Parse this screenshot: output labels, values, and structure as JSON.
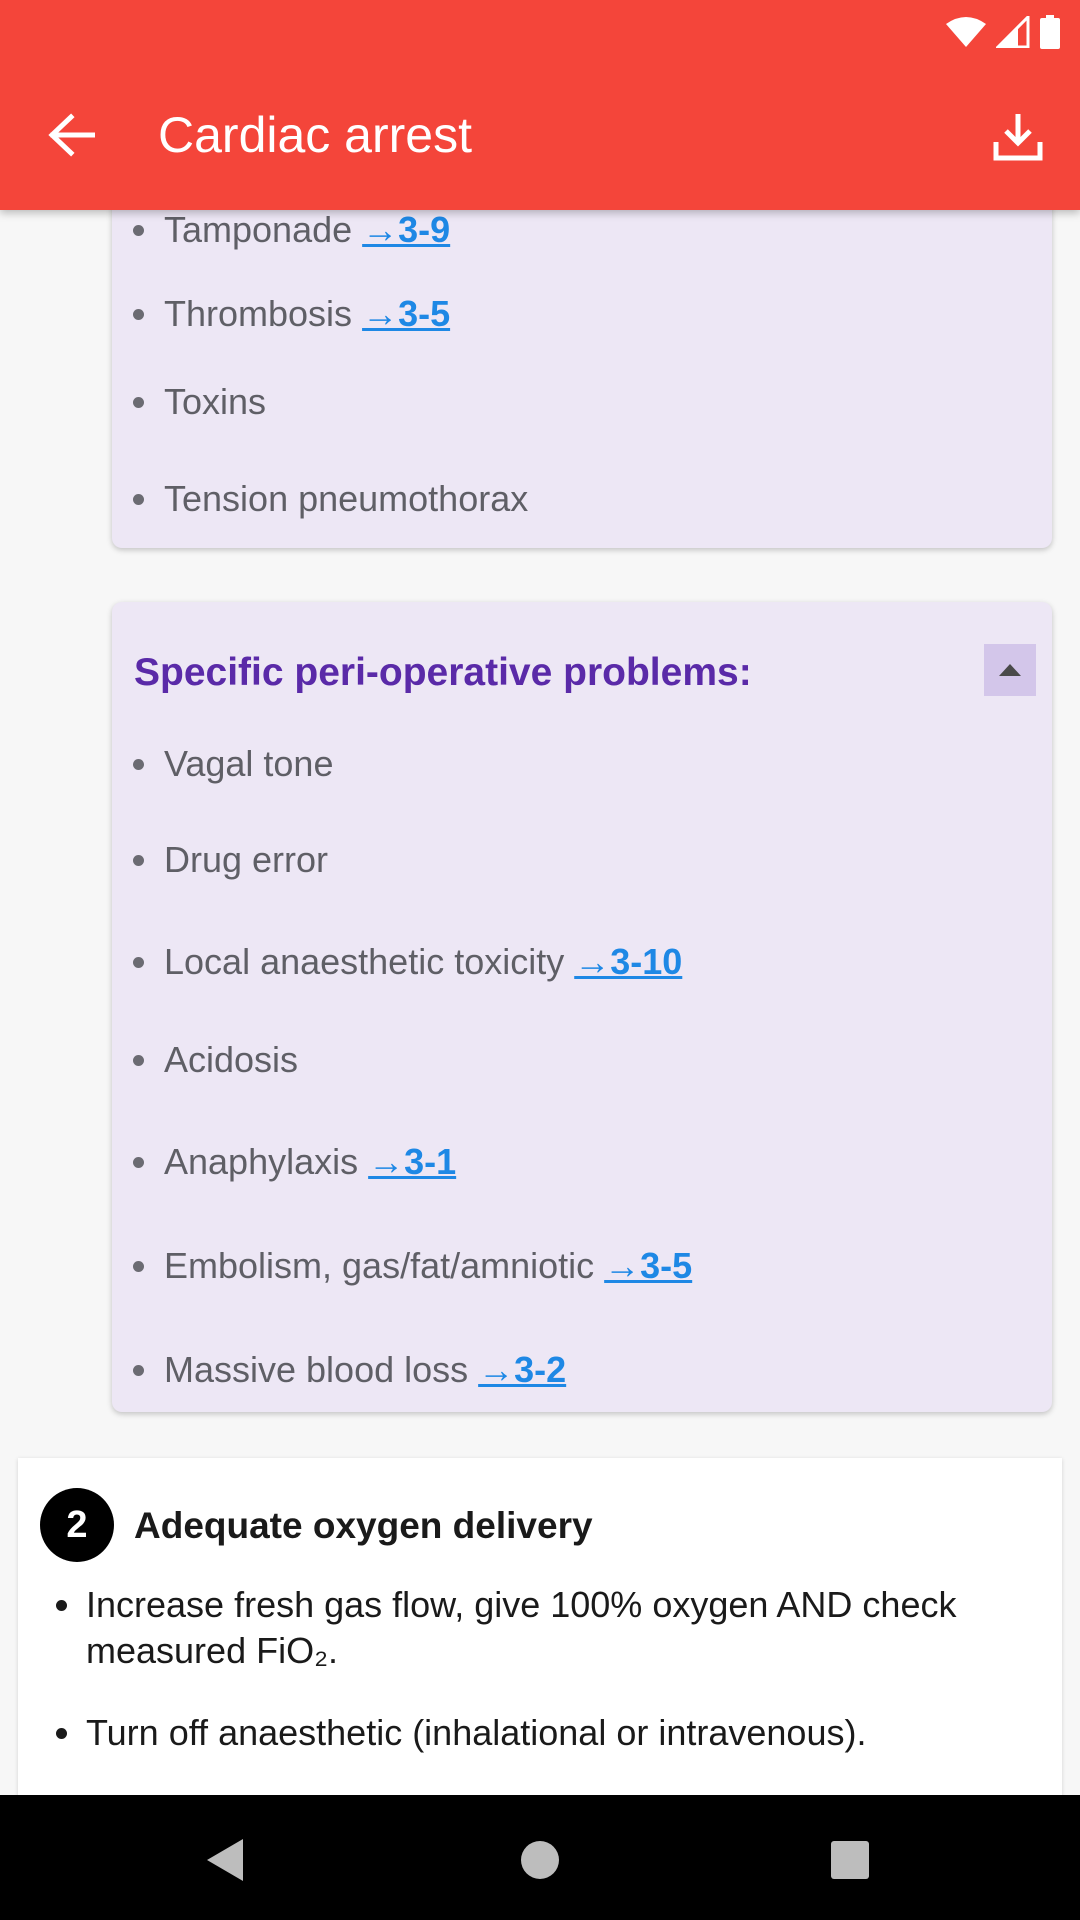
{
  "app_bar": {
    "title": "Cardiac arrest",
    "back_icon": "arrow-left-icon",
    "download_icon": "download-icon",
    "color": "#f4453a"
  },
  "status_bar": {
    "icons": [
      "wifi-icon",
      "cell-signal-icon",
      "battery-icon"
    ]
  },
  "panel_causes": {
    "items": [
      {
        "label": "Tamponade",
        "ref": "→3-9"
      },
      {
        "label": "Thrombosis",
        "ref": "→3-5"
      },
      {
        "label": "Toxins",
        "ref": ""
      },
      {
        "label": "Tension pneumothorax",
        "ref": ""
      }
    ]
  },
  "panel_periop": {
    "heading": "Specific peri-operative problems:",
    "collapse_icon": "caret-up-icon",
    "items": [
      {
        "label": "Vagal tone",
        "ref": ""
      },
      {
        "label": "Drug error",
        "ref": ""
      },
      {
        "label": "Local anaesthetic toxicity",
        "ref": "→3-10"
      },
      {
        "label": "Acidosis",
        "ref": ""
      },
      {
        "label": "Anaphylaxis",
        "ref": "→3-1"
      },
      {
        "label": "Embolism, gas/fat/amniotic",
        "ref": "→3-5"
      },
      {
        "label": "Massive blood loss",
        "ref": "→3-2"
      }
    ]
  },
  "step2": {
    "number": "2",
    "title": "Adequate oxygen delivery",
    "items": [
      "Increase fresh gas flow, give 100% oxygen AND check measured FiO₂.",
      "Turn off anaesthetic (inhalational or intravenous)."
    ]
  },
  "nav_bar": {
    "icons": [
      "back-triangle-icon",
      "home-circle-icon",
      "recents-square-icon"
    ]
  },
  "colors": {
    "panel_bg": "#ede7f5",
    "heading": "#5a2aa8",
    "link": "#1e88e5"
  }
}
